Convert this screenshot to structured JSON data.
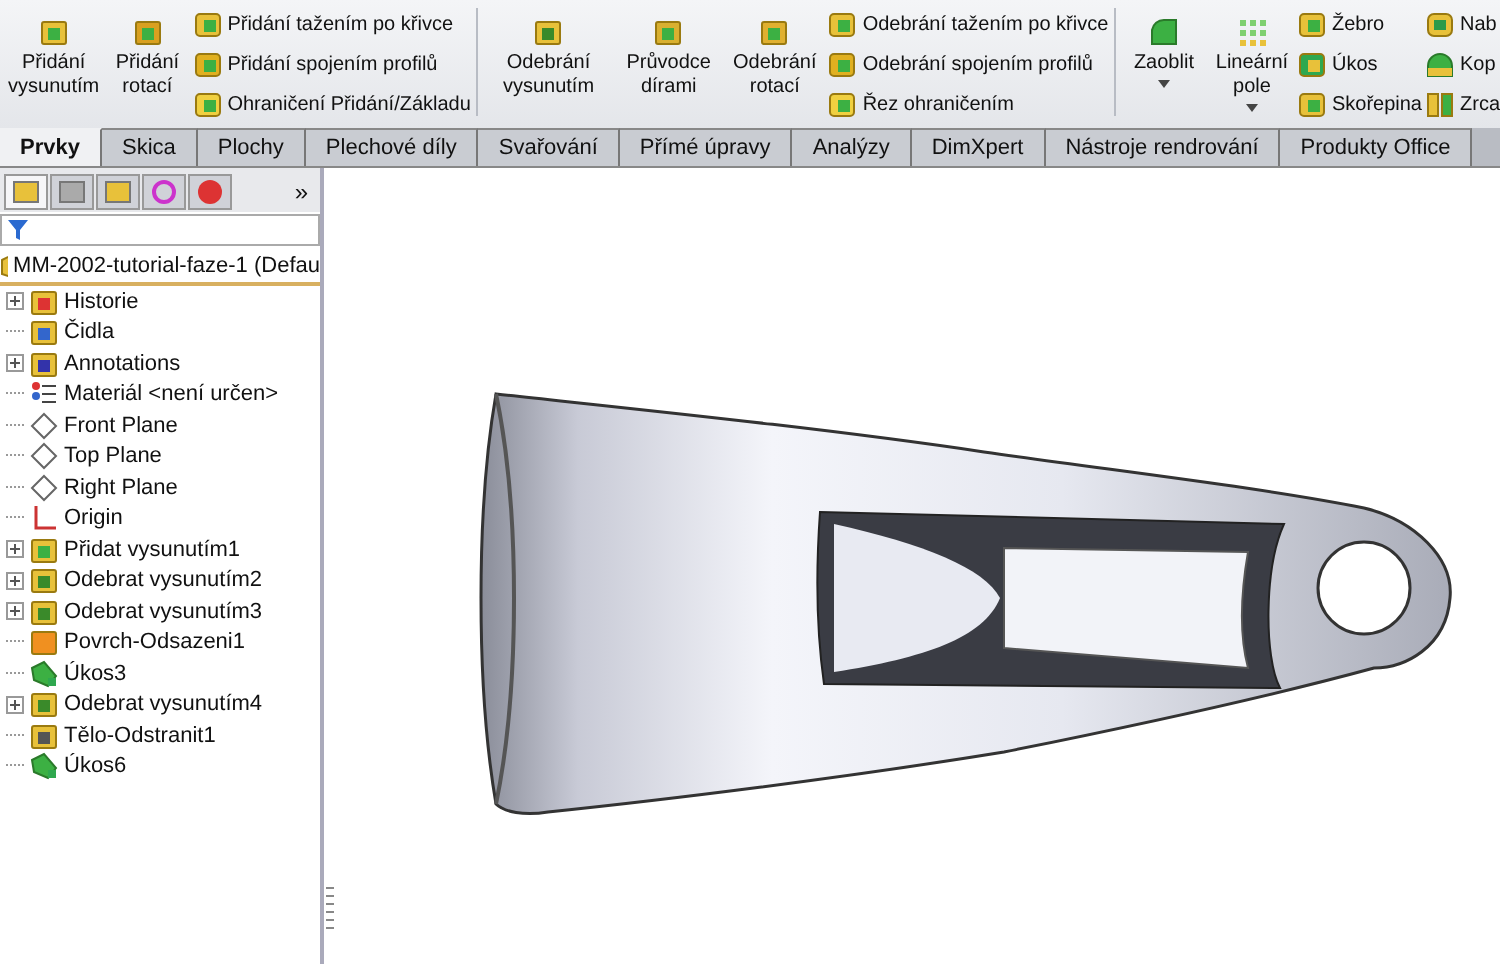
{
  "toolbar": {
    "groups": [
      {
        "big": [
          {
            "label": "Přidání vysunutím",
            "kind": "extrude",
            "caret": false
          },
          {
            "label": "Přidání rotací",
            "kind": "revolve",
            "caret": false
          }
        ],
        "small": [
          {
            "label": "Přidání tažením po křivce",
            "kind": "sweep"
          },
          {
            "label": "Přidání spojením profilů",
            "kind": "loft"
          },
          {
            "label": "Ohraničení Přidání/Základu",
            "kind": "boundary"
          }
        ]
      },
      {
        "big": [
          {
            "label": "Odebrání vysunutím",
            "kind": "cut",
            "caret": false
          },
          {
            "label": "Průvodce dírami",
            "kind": "hole",
            "caret": false
          },
          {
            "label": "Odebrání rotací",
            "kind": "cutrevolve",
            "caret": false
          }
        ],
        "small": [
          {
            "label": "Odebrání tažením po křivce",
            "kind": "sweep"
          },
          {
            "label": "Odebrání spojením profilů",
            "kind": "loft"
          },
          {
            "label": "Řez ohraničením",
            "kind": "boundary"
          }
        ]
      },
      {
        "big": [
          {
            "label": "Zaoblit",
            "kind": "fillet",
            "caret": true
          },
          {
            "label": "Lineární pole",
            "kind": "pattern",
            "caret": true
          }
        ],
        "small": [
          {
            "label": "Žebro",
            "kind": "rib"
          },
          {
            "label": "Úkos",
            "kind": "draft"
          },
          {
            "label": "Skořepina",
            "kind": "shell"
          }
        ],
        "small2": [
          {
            "label": "Nab",
            "kind": "wrap"
          },
          {
            "label": "Kop",
            "kind": "dome"
          },
          {
            "label": "Zrca",
            "kind": "mirror"
          }
        ]
      }
    ]
  },
  "tabs": [
    {
      "label": "Prvky",
      "selected": true
    },
    {
      "label": "Skica",
      "selected": false
    },
    {
      "label": "Plochy",
      "selected": false
    },
    {
      "label": "Plechové díly",
      "selected": false
    },
    {
      "label": "Svařování",
      "selected": false
    },
    {
      "label": "Přímé úpravy",
      "selected": false
    },
    {
      "label": "Analýzy",
      "selected": false
    },
    {
      "label": "DimXpert",
      "selected": false
    },
    {
      "label": "Nástroje rendrování",
      "selected": false
    },
    {
      "label": "Produkty Office",
      "selected": false
    }
  ],
  "panel": {
    "tabs": [
      {
        "kind": "tree",
        "selected": true
      },
      {
        "kind": "property",
        "selected": false
      },
      {
        "kind": "config",
        "selected": false
      },
      {
        "kind": "dimxpert",
        "selected": false
      },
      {
        "kind": "display",
        "selected": false
      }
    ],
    "more": "»",
    "root": "MM-2002-tutorial-faze-1  (Defau",
    "items": [
      {
        "label": "Historie",
        "kind": "history",
        "expandable": true
      },
      {
        "label": "Čidla",
        "kind": "sensor",
        "expandable": false
      },
      {
        "label": "Annotations",
        "kind": "annotation",
        "expandable": true
      },
      {
        "label": "Materiál <není určen>",
        "kind": "material",
        "expandable": false
      },
      {
        "label": "Front Plane",
        "kind": "plane",
        "expandable": false
      },
      {
        "label": "Top Plane",
        "kind": "plane",
        "expandable": false
      },
      {
        "label": "Right Plane",
        "kind": "plane",
        "expandable": false
      },
      {
        "label": "Origin",
        "kind": "origin",
        "expandable": false
      },
      {
        "label": "Přidat vysunutím1",
        "kind": "extrude",
        "expandable": true
      },
      {
        "label": "Odebrat vysunutím2",
        "kind": "cut",
        "expandable": true
      },
      {
        "label": "Odebrat vysunutím3",
        "kind": "cut",
        "expandable": true
      },
      {
        "label": "Povrch-Odsazeni1",
        "kind": "surface",
        "expandable": false
      },
      {
        "label": "Úkos3",
        "kind": "draft",
        "expandable": false
      },
      {
        "label": "Odebrat vysunutím4",
        "kind": "cut",
        "expandable": true
      },
      {
        "label": "Tělo-Odstranit1",
        "kind": "body",
        "expandable": false
      },
      {
        "label": "Úkos6",
        "kind": "draft",
        "expandable": false
      }
    ]
  }
}
